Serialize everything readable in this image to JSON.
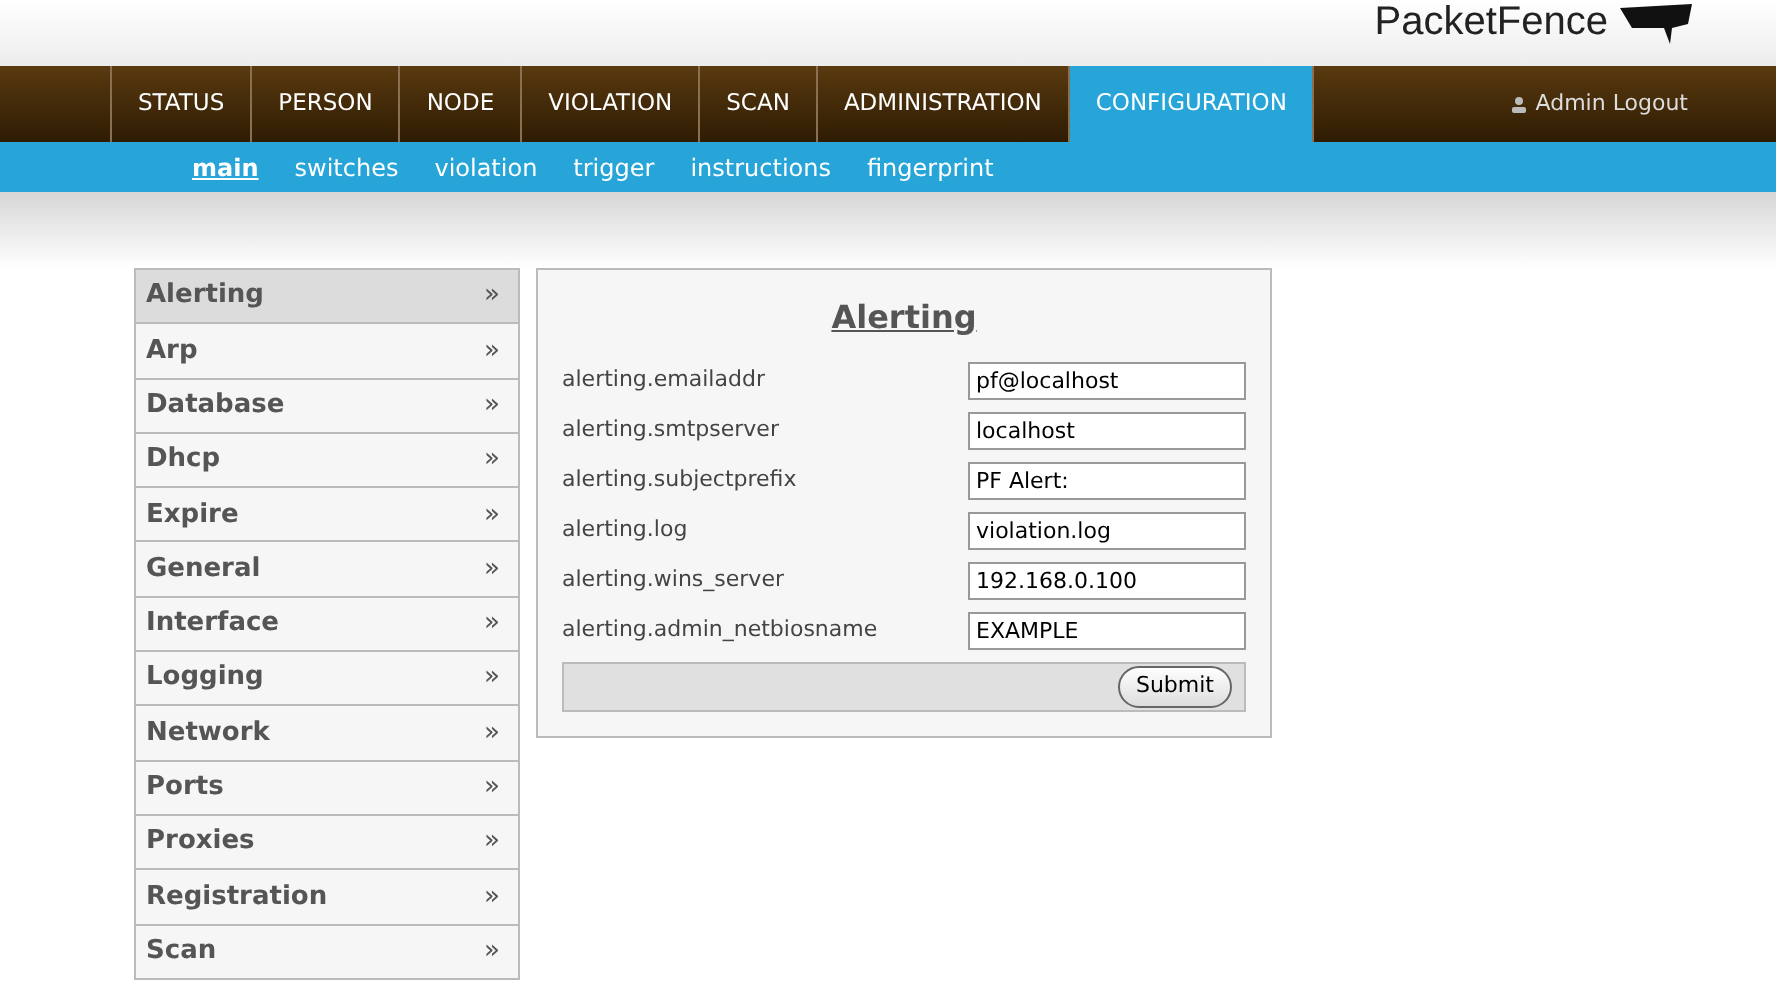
{
  "logo": {
    "text": "PacketFence"
  },
  "nav": {
    "tabs": [
      {
        "label": "STATUS",
        "selected": false
      },
      {
        "label": "PERSON",
        "selected": false
      },
      {
        "label": "NODE",
        "selected": false
      },
      {
        "label": "VIOLATION",
        "selected": false
      },
      {
        "label": "SCAN",
        "selected": false
      },
      {
        "label": "ADMINISTRATION",
        "selected": false
      },
      {
        "label": "CONFIGURATION",
        "selected": true
      }
    ],
    "logout": "Admin Logout"
  },
  "subnav": [
    {
      "label": "main",
      "selected": true
    },
    {
      "label": "switches",
      "selected": false
    },
    {
      "label": "violation",
      "selected": false
    },
    {
      "label": "trigger",
      "selected": false
    },
    {
      "label": "instructions",
      "selected": false
    },
    {
      "label": "fingerprint",
      "selected": false
    }
  ],
  "sidebar": {
    "items": [
      {
        "label": "Alerting",
        "selected": true,
        "arrow": "»"
      },
      {
        "label": "Arp",
        "selected": false,
        "arrow": "»"
      },
      {
        "label": "Database",
        "selected": false,
        "arrow": "»"
      },
      {
        "label": "Dhcp",
        "selected": false,
        "arrow": "»"
      },
      {
        "label": "Expire",
        "selected": false,
        "arrow": "»"
      },
      {
        "label": "General",
        "selected": false,
        "arrow": "»"
      },
      {
        "label": "Interface",
        "selected": false,
        "arrow": "»"
      },
      {
        "label": "Logging",
        "selected": false,
        "arrow": "»"
      },
      {
        "label": "Network",
        "selected": false,
        "arrow": "»"
      },
      {
        "label": "Ports",
        "selected": false,
        "arrow": "»"
      },
      {
        "label": "Proxies",
        "selected": false,
        "arrow": "»"
      },
      {
        "label": "Registration",
        "selected": false,
        "arrow": "»"
      },
      {
        "label": "Scan",
        "selected": false,
        "arrow": "»"
      }
    ]
  },
  "form": {
    "title": "Alerting",
    "fields": [
      {
        "label": "alerting.emailaddr",
        "value": "pf@localhost"
      },
      {
        "label": "alerting.smtpserver",
        "value": "localhost"
      },
      {
        "label": "alerting.subjectprefix",
        "value": "PF Alert:"
      },
      {
        "label": "alerting.log",
        "value": "violation.log"
      },
      {
        "label": "alerting.wins_server",
        "value": "192.168.0.100"
      },
      {
        "label": "alerting.admin_netbiosname",
        "value": "EXAMPLE"
      }
    ],
    "submit": "Submit"
  }
}
